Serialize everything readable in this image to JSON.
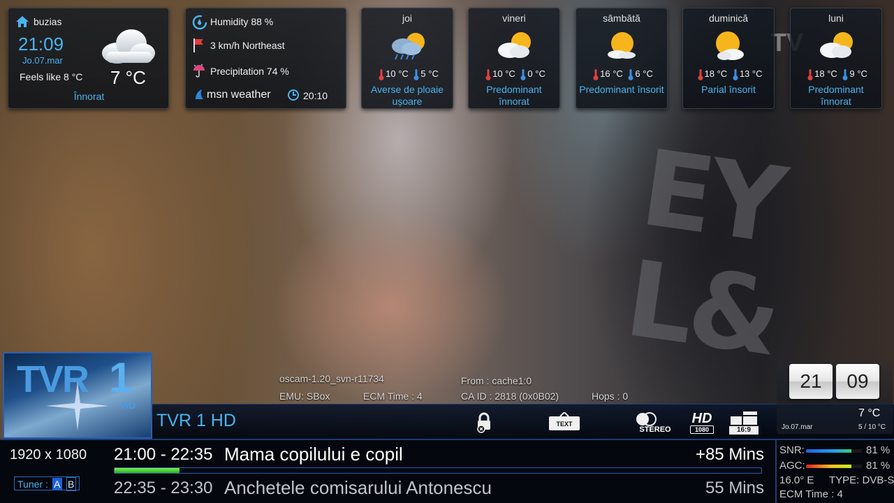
{
  "weather_now": {
    "location": "buzias",
    "time": "21:09",
    "date": "Jo.07.mar",
    "feels_like": "Feels like 8 °C",
    "temperature": "7 °C",
    "condition": "Înnorat"
  },
  "weather_details": {
    "humidity": "Humidity 88 %",
    "wind": "3 km/h Northeast",
    "precipitation": "Precipitation 74 %",
    "provider": "msn weather",
    "updated": "20:10"
  },
  "forecast": [
    {
      "day": "joi",
      "high": "10 °C",
      "low": "5 °C",
      "condition": "Averse de ploaie ușoare",
      "icon": "rain-cloud-sun-icon"
    },
    {
      "day": "vineri",
      "high": "10 °C",
      "low": "0 °C",
      "condition": "Predominant înnorat",
      "icon": "cloud-sun-icon"
    },
    {
      "day": "sâmbătă",
      "high": "16 °C",
      "low": "6 °C",
      "condition": "Predominant însorit",
      "icon": "sun-cloud-icon"
    },
    {
      "day": "duminică",
      "high": "18 °C",
      "low": "13 °C",
      "condition": "Parial însorit",
      "icon": "partly-sunny-icon"
    },
    {
      "day": "luni",
      "high": "18 °C",
      "low": "9 °C",
      "condition": "Predominant înnorat",
      "icon": "cloud-sun-icon"
    }
  ],
  "watermark": "TV",
  "ecm": {
    "cam": "oscam-1.20_svn-r11734",
    "emu": "EMU: SBox",
    "ecm_time": "ECM Time : 4",
    "from": "From : cache1:0",
    "caid": "CA ID : 2818 (0x0B02)",
    "hops": "Hops : 0"
  },
  "channel": {
    "logo_text": "TVR",
    "logo_number": "1",
    "logo_hd": "HD",
    "name": "TVR 1 HD"
  },
  "badges": {
    "text": "TEXT",
    "stereo": "STEREO",
    "hd": "HD",
    "hd_res": "1080",
    "aspect": "16:9"
  },
  "clock": {
    "hours": "21",
    "minutes": "09",
    "temperature": "7 °C",
    "date": "Jo.07.mar",
    "range": "5 / 10 °C"
  },
  "video": {
    "resolution": "1920 x 1080",
    "tuner_label": "Tuner :",
    "tuner_a": "A",
    "tuner_b": "B"
  },
  "epg": {
    "now_time": "21:00 - 22:35",
    "now_title": "Mama copilului e copil",
    "now_remaining": "+85 Mins",
    "progress": 0.1,
    "next_time": "22:35 - 23:30",
    "next_title": "Anchetele comisarului Antonescu",
    "next_remaining": "55 Mins"
  },
  "signal": {
    "snr_label": "SNR:",
    "snr_value": "81 %",
    "snr_level": 0.81,
    "agc_label": "AGC:",
    "agc_value": "81 %",
    "agc_level": 0.81,
    "orbital": "16.0° E",
    "type": "TYPE: DVB-S",
    "ecm_time": "ECM Time : 4"
  },
  "colors": {
    "accent_blue": "#4ab3f0",
    "progress_green": "#3cd02a",
    "tuner_active": "#1e60d8"
  }
}
